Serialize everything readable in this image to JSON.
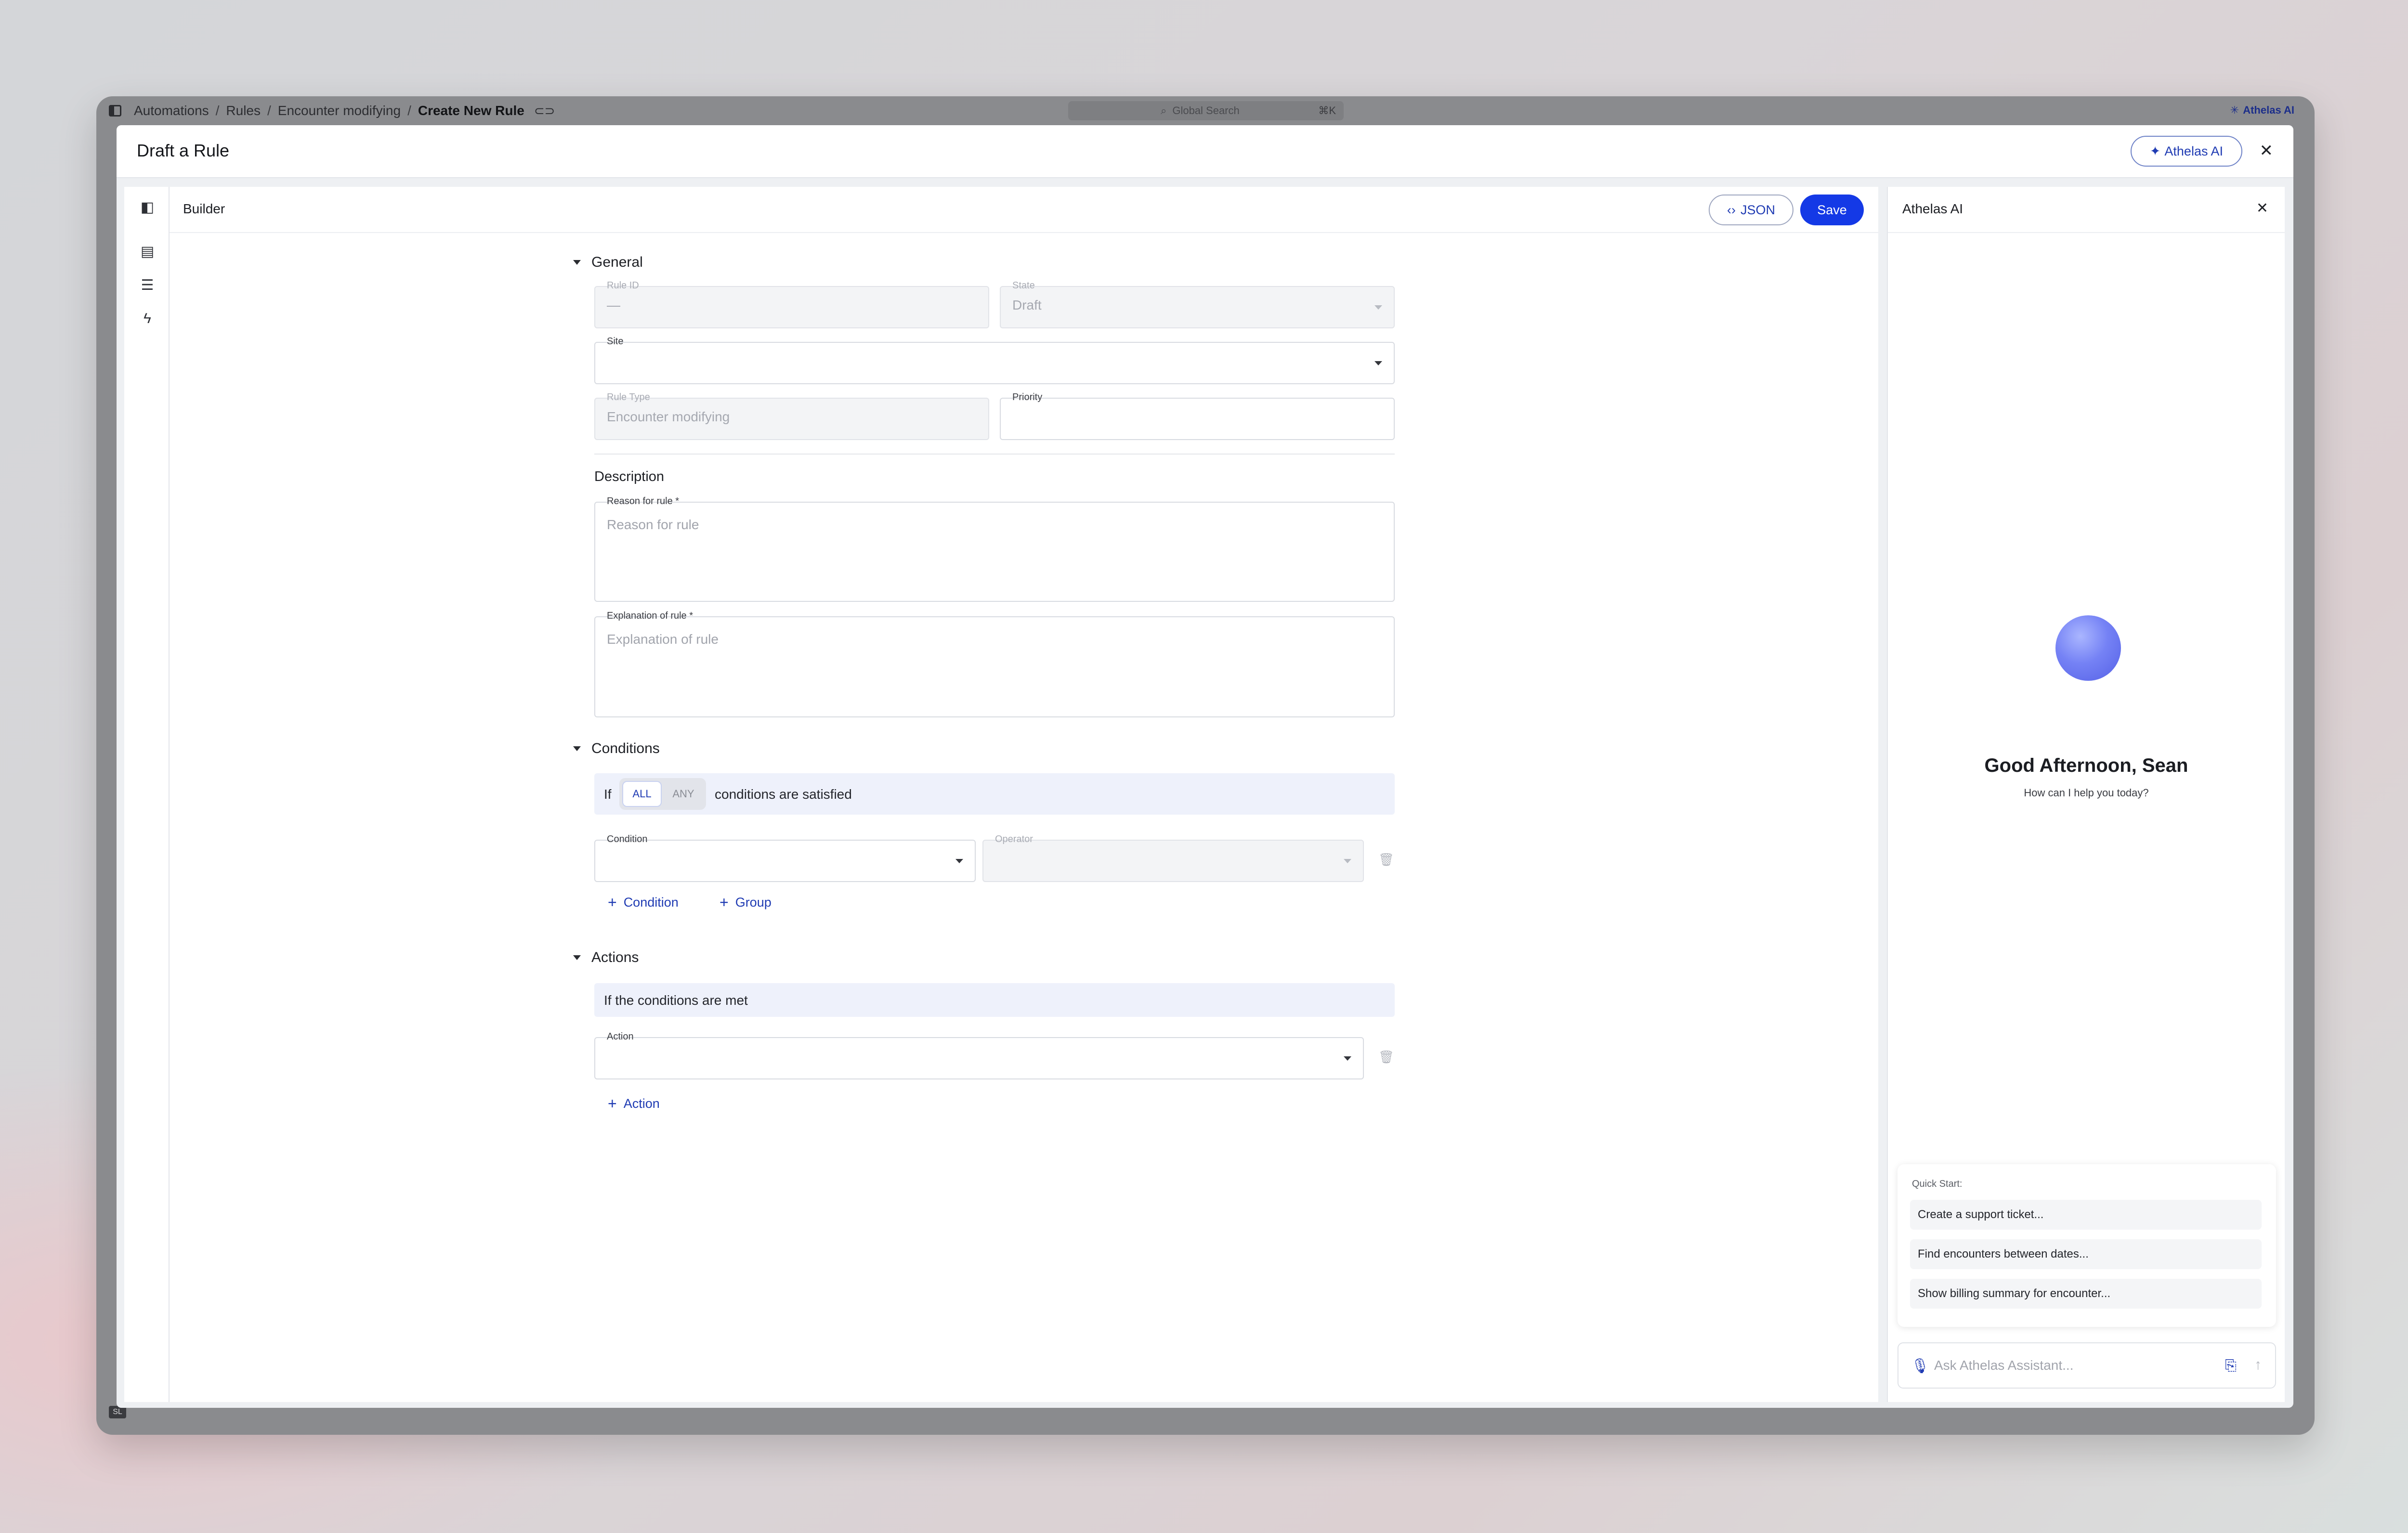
{
  "topbar": {
    "breadcrumbs": [
      "Automations",
      "Rules",
      "Encounter modifying",
      "Create New Rule"
    ],
    "search_placeholder": "Global Search",
    "search_shortcut": "⌘K",
    "ai_label": "Athelas AI",
    "user_initials": "SL"
  },
  "modal": {
    "title": "Draft a Rule",
    "ai_button": "Athelas AI"
  },
  "builder": {
    "title": "Builder",
    "json_button": "JSON",
    "save_button": "Save",
    "general": {
      "heading": "General",
      "rule_id_label": "Rule ID",
      "rule_id_value": "—",
      "state_label": "State",
      "state_value": "Draft",
      "site_label": "Site",
      "site_value": "",
      "rule_type_label": "Rule Type",
      "rule_type_value": "Encounter modifying",
      "priority_label": "Priority",
      "priority_value": ""
    },
    "description": {
      "heading": "Description",
      "reason_label": "Reason for rule *",
      "reason_placeholder": "Reason for rule",
      "explanation_label": "Explanation of rule *",
      "explanation_placeholder": "Explanation of rule"
    },
    "conditions": {
      "heading": "Conditions",
      "if_text": "If",
      "all_option": "ALL",
      "any_option": "ANY",
      "selected": "ALL",
      "suffix_text": "conditions are satisfied",
      "condition_label": "Condition",
      "operator_label": "Operator",
      "add_condition": "Condition",
      "add_group": "Group"
    },
    "actions": {
      "heading": "Actions",
      "if_met_text": "If the conditions are met",
      "action_label": "Action",
      "add_action": "Action"
    }
  },
  "ai_panel": {
    "title": "Athelas AI",
    "greeting": "Good Afternoon, Sean",
    "subtitle": "How can I help you today?",
    "quick_start_title": "Quick Start:",
    "quick_start_items": [
      "Create a support ticket...",
      "Find encounters between dates...",
      "Show billing summary for encounter..."
    ],
    "chat_placeholder": "Ask Athelas Assistant..."
  },
  "colors": {
    "accent": "#1439e6",
    "accent_text": "#1f3bb3",
    "condition_bar": "#eef1fb"
  },
  "icons": [
    "sidebar-toggle-icon",
    "link-icon",
    "search-icon",
    "sparkle-icon",
    "close-icon",
    "code-icon",
    "panel-icon",
    "notes-icon",
    "filter-icon",
    "lightning-icon",
    "trash-icon",
    "plus-icon",
    "mic-icon",
    "attach-file-icon",
    "send-arrow-icon"
  ]
}
